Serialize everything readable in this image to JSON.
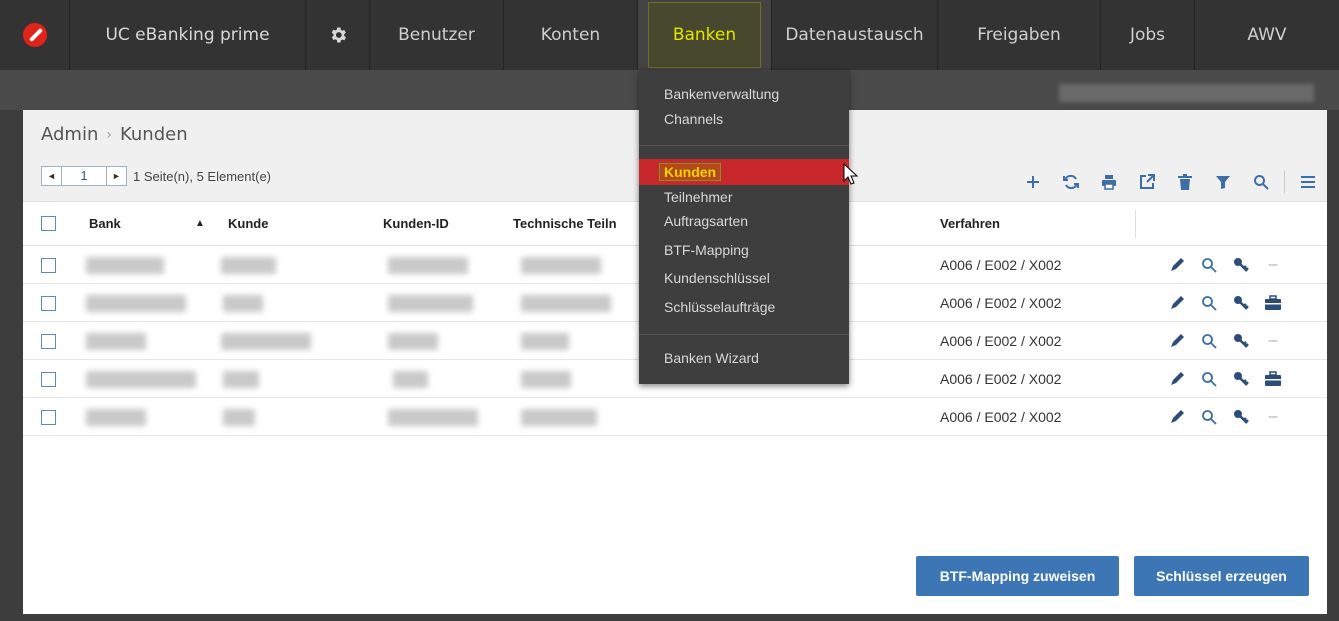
{
  "nav": {
    "app_title": "UC eBanking prime",
    "items": [
      {
        "label": "Benutzer"
      },
      {
        "label": "Konten"
      },
      {
        "label": "Banken"
      },
      {
        "label": "Datenaustausch"
      },
      {
        "label": "Freigaben"
      },
      {
        "label": "Jobs"
      },
      {
        "label": "AWV"
      }
    ],
    "active": "Banken"
  },
  "breadcrumb": {
    "root": "Admin",
    "separator": "›",
    "current": "Kunden"
  },
  "pager": {
    "prev": "◄",
    "page": "1",
    "next": "►",
    "info": "1 Seite(n), 5 Element(e)"
  },
  "toolbar": {
    "add_icon": "plus-icon",
    "refresh_icon": "refresh-icon",
    "print_icon": "print-icon",
    "export_icon": "export-icon",
    "delete_icon": "trash-icon",
    "filter_icon": "filter-icon",
    "search_icon": "search-icon",
    "menu_icon": "hamburger-icon"
  },
  "table": {
    "columns": [
      "Bank",
      "Kunde",
      "Kunden-ID",
      "Technische Teiln",
      "Verfahren"
    ],
    "sort_indicator": "▲",
    "rows": [
      {
        "verfahren": "A006 / E002 / X002",
        "has_briefcase": false
      },
      {
        "verfahren": "A006 / E002 / X002",
        "has_briefcase": true
      },
      {
        "verfahren": "A006 / E002 / X002",
        "has_briefcase": false
      },
      {
        "verfahren": "A006 / E002 / X002",
        "has_briefcase": true
      },
      {
        "verfahren": "A006 / E002 / X002",
        "has_briefcase": false
      }
    ]
  },
  "buttons": {
    "btf": "BTF-Mapping zuweisen",
    "key": "Schlüssel erzeugen"
  },
  "dropdown": {
    "items_group1": [
      "Bankenverwaltung",
      "Channels"
    ],
    "items_group2": [
      "Kunden",
      "Teilnehmer",
      "Auftragsarten",
      "BTF-Mapping",
      "Kundenschlüssel",
      "Schlüsselaufträge"
    ],
    "items_group3": [
      "Banken Wizard"
    ],
    "active": "Kunden"
  },
  "colors": {
    "accent": "#3d76b5",
    "nav_bg": "#333333",
    "active_menu": "#c8282c",
    "highlight": "#e5e500"
  }
}
